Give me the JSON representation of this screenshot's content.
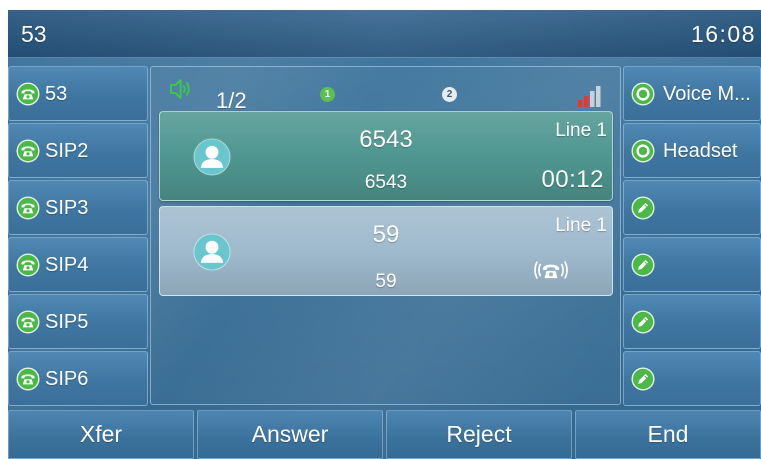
{
  "status_bar": {
    "account": "53",
    "time": "16:08"
  },
  "line_keys_left": [
    {
      "label": "53",
      "icon": "desk-phone-icon"
    },
    {
      "label": "SIP2",
      "icon": "desk-phone-icon"
    },
    {
      "label": "SIP3",
      "icon": "desk-phone-icon"
    },
    {
      "label": "SIP4",
      "icon": "desk-phone-icon"
    },
    {
      "label": "SIP5",
      "icon": "desk-phone-icon"
    },
    {
      "label": "SIP6",
      "icon": "desk-phone-icon"
    }
  ],
  "line_keys_right": [
    {
      "label": "Voice M...",
      "icon": "radio-indicator-icon"
    },
    {
      "label": "Headset",
      "icon": "radio-indicator-icon"
    },
    {
      "icon": "pencil-icon"
    },
    {
      "icon": "pencil-icon"
    },
    {
      "icon": "pencil-icon"
    },
    {
      "icon": "pencil-icon"
    }
  ],
  "call_panel": {
    "header": {
      "audio_icon": "speakerphone-icon",
      "call_counter": "1/2",
      "page_dots": [
        {
          "label": "1",
          "active": true
        },
        {
          "label": "2",
          "active": false
        }
      ],
      "signal_icon": "signal-strength-icon"
    },
    "calls": [
      {
        "display_name": "6543",
        "number": "6543",
        "line": "Line 1",
        "duration": "00:12",
        "avatar_icon": "contact-avatar-icon"
      },
      {
        "display_name": "59",
        "number": "59",
        "line": "Line 1",
        "status_icon": "ringing-phone-icon",
        "avatar_icon": "contact-avatar-icon"
      }
    ]
  },
  "softkeys": [
    {
      "label": "Xfer"
    },
    {
      "label": "Answer"
    },
    {
      "label": "Reject"
    },
    {
      "label": "End"
    }
  ],
  "colors": {
    "screen_background": "#37709b",
    "status_bar": "#2a5d8a",
    "key_icon_green": "#4cb848",
    "speaker_green": "#3fcc3f",
    "active_call_card": "#4e9690",
    "incoming_call_card": "#9db8cc",
    "avatar_background": "#68c6cc",
    "signal_red": "#e8372b",
    "page_dot_active": "#5cbf4e"
  }
}
